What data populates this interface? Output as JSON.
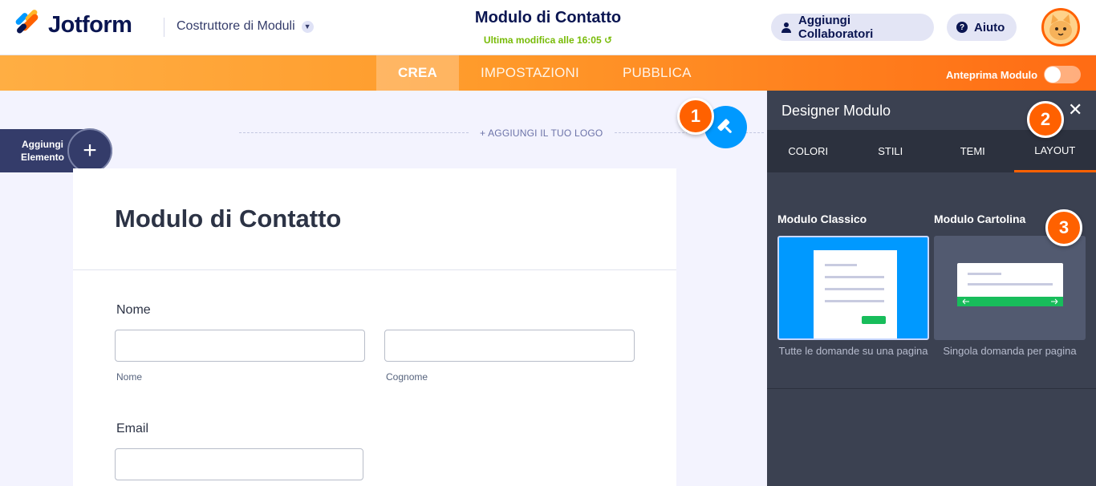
{
  "header": {
    "brand": "Jotform",
    "builder_menu": "Costruttore di Moduli",
    "form_title": "Modulo di Contatto",
    "last_modified": "Ultima modifica alle 16:05",
    "collaborators_button": "Aggiungi Collaboratori",
    "help_button": "Aiuto"
  },
  "nav": {
    "tabs": [
      {
        "label": "CREA",
        "active": true
      },
      {
        "label": "IMPOSTAZIONI",
        "active": false
      },
      {
        "label": "PUBBLICA",
        "active": false
      }
    ],
    "preview_label": "Anteprima Modulo"
  },
  "canvas": {
    "add_element_label": "Aggiungi Elemento",
    "add_logo": "+ AGGIUNGI IL TUO LOGO"
  },
  "form": {
    "title": "Modulo di Contatto",
    "name_label": "Nome",
    "first_sublabel": "Nome",
    "last_sublabel": "Cognome",
    "email_label": "Email"
  },
  "panel": {
    "title": "Designer Modulo",
    "tabs": [
      {
        "label": "COLORI",
        "active": false
      },
      {
        "label": "STILI",
        "active": false
      },
      {
        "label": "TEMI",
        "active": false
      },
      {
        "label": "LAYOUT",
        "active": true
      }
    ],
    "options": [
      {
        "title": "Modulo Classico",
        "description": "Tutte le domande su una pagina",
        "selected": true
      },
      {
        "title": "Modulo Cartolina",
        "description": "Singola domanda per pagina",
        "selected": false
      }
    ]
  },
  "markers": [
    "1",
    "2",
    "3"
  ],
  "colors": {
    "accent": "#ff6100",
    "primary_blue": "#0099ff",
    "navy": "#0a1551",
    "success_green": "#78bb07",
    "panel_bg": "#3b4151"
  }
}
